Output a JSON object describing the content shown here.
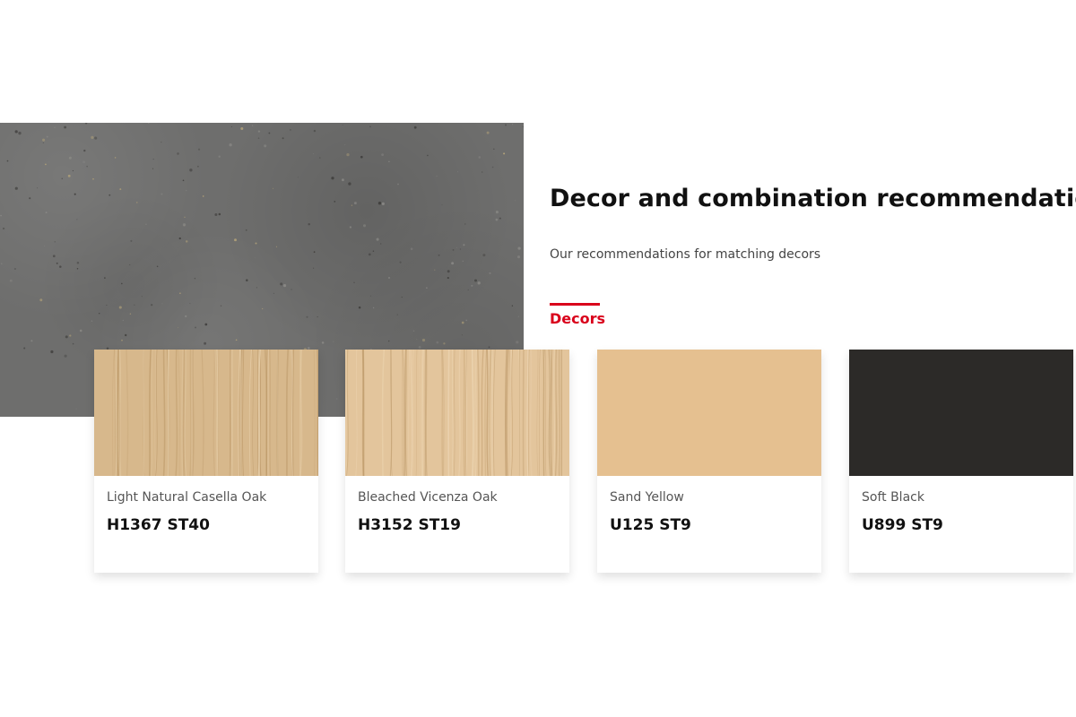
{
  "section": {
    "heading": "Decor and combination recommendations",
    "subtitle": "Our recommendations for matching decors"
  },
  "tabs": [
    {
      "label": "Decors",
      "active": true
    }
  ],
  "colors": {
    "accent": "#d9001b",
    "concrete": "#6e6e6d"
  },
  "decors": [
    {
      "name": "Light Natural Casella Oak",
      "code": "H1367 ST40",
      "swatch": "wood",
      "color": "#d7b88c"
    },
    {
      "name": "Bleached Vicenza Oak",
      "code": "H3152 ST19",
      "swatch": "wood",
      "color": "#e3c59c"
    },
    {
      "name": "Sand Yellow",
      "code": "U125 ST9",
      "swatch": "solid",
      "color": "#e5c090"
    },
    {
      "name": "Soft Black",
      "code": "U899 ST9",
      "swatch": "solid",
      "color": "#2c2a28"
    }
  ]
}
